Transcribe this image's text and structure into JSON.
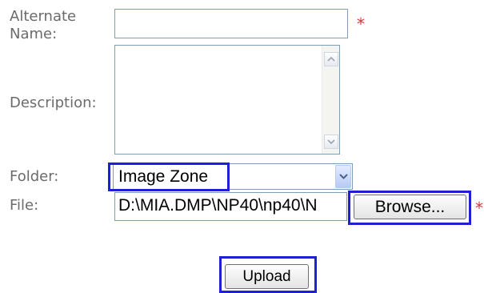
{
  "form": {
    "alternate_name": {
      "label_line1": "Alternate",
      "label_line2": "Name:",
      "value": "",
      "required_mark": "*"
    },
    "description": {
      "label": "Description:",
      "value": ""
    },
    "folder": {
      "label": "Folder:",
      "selected": "Image Zone"
    },
    "file": {
      "label": "File:",
      "path": "D:\\MIA.DMP\\NP40\\np40\\N",
      "browse_label": "Browse...",
      "required_mark": "*"
    },
    "upload_label": "Upload"
  },
  "colors": {
    "highlight": "#1f1fd8",
    "required": "#e0303a",
    "label": "#6b6b6b",
    "field_border": "#7f9db9"
  },
  "icons": [
    "scroll-up-arrow-icon",
    "scroll-down-arrow-icon",
    "dropdown-chevron-icon"
  ]
}
